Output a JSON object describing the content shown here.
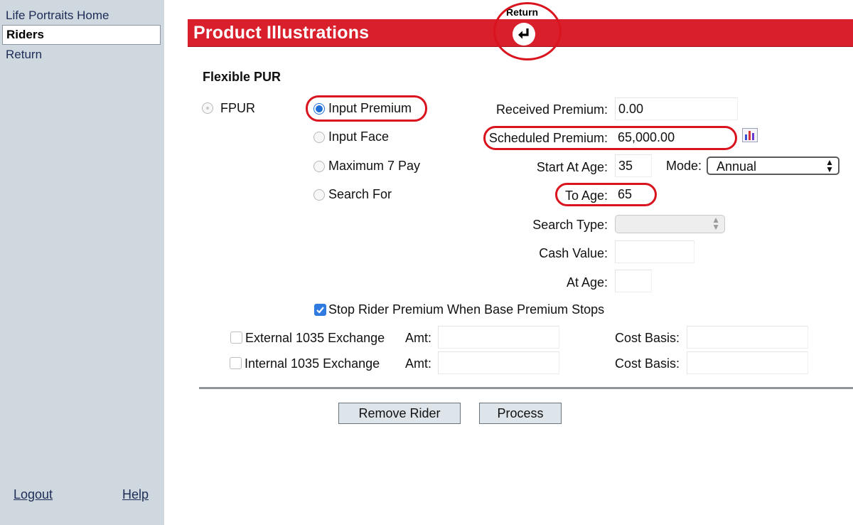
{
  "sidebar": {
    "items": [
      {
        "label": "Life Portraits Home"
      },
      {
        "label": "Riders"
      },
      {
        "label": "Return"
      }
    ],
    "logout_label": "Logout",
    "help_label": "Help"
  },
  "header": {
    "title": "Product Illustrations",
    "return_label": "Return"
  },
  "section_title": "Flexible PUR",
  "product_option": "FPUR",
  "radio_options": [
    {
      "label": "Input Premium",
      "selected": true
    },
    {
      "label": "Input Face",
      "selected": false
    },
    {
      "label": "Maximum 7 Pay",
      "selected": false
    },
    {
      "label": "Search For",
      "selected": false
    }
  ],
  "fields": {
    "received_premium": {
      "label": "Received Premium:",
      "value": "0.00"
    },
    "scheduled_premium": {
      "label": "Scheduled Premium:",
      "value": "65,000.00"
    },
    "start_at_age": {
      "label": "Start At Age:",
      "value": "35"
    },
    "mode": {
      "label": "Mode:",
      "value": "Annual"
    },
    "to_age": {
      "label": "To Age:",
      "value": "65"
    },
    "search_type": {
      "label": "Search Type:",
      "value": ""
    },
    "cash_value": {
      "label": "Cash Value:",
      "value": ""
    },
    "at_age": {
      "label": "At Age:",
      "value": ""
    }
  },
  "stop_rider_label": "Stop Rider Premium When Base Premium Stops",
  "exchanges": [
    {
      "label": "External 1035 Exchange",
      "amt_label": "Amt:",
      "cost_basis_label": "Cost Basis:"
    },
    {
      "label": "Internal 1035 Exchange",
      "amt_label": "Amt:",
      "cost_basis_label": "Cost Basis:"
    }
  ],
  "buttons": {
    "remove_rider": "Remove Rider",
    "process": "Process"
  },
  "colors": {
    "header_red": "#d91f2c",
    "sidebar_bg": "#cfd8df",
    "annotation_red": "#d9141e",
    "accent_blue": "#1f6fd8"
  }
}
